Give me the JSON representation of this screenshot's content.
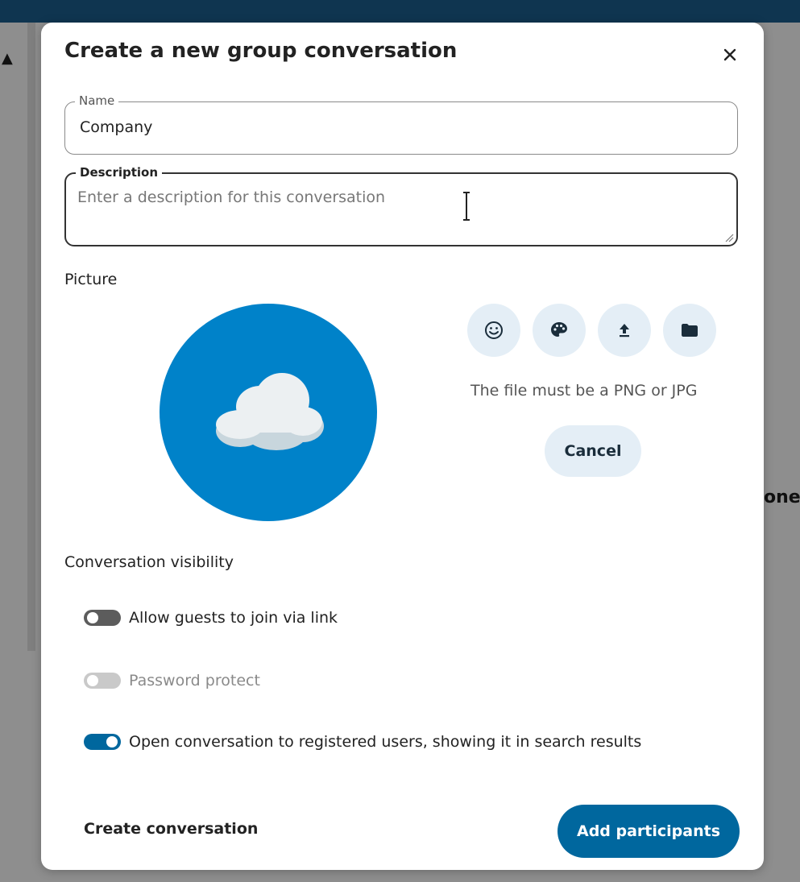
{
  "dialog": {
    "title": "Create a new group conversation",
    "close_icon": "close-icon"
  },
  "name_field": {
    "legend": "Name",
    "value": "Company"
  },
  "description_field": {
    "legend": "Description",
    "placeholder": "Enter a description for this conversation"
  },
  "picture": {
    "label": "Picture",
    "avatar_icon": "cloud-icon",
    "avatar_color": "#0082c9",
    "actions": [
      {
        "icon": "emoji-icon"
      },
      {
        "icon": "palette-icon"
      },
      {
        "icon": "upload-icon"
      },
      {
        "icon": "folder-icon"
      }
    ],
    "hint": "The file must be a PNG or JPG",
    "cancel_label": "Cancel"
  },
  "visibility": {
    "label": "Conversation visibility",
    "toggles": [
      {
        "label": "Allow guests to join via link",
        "state": "off",
        "enabled": true
      },
      {
        "label": "Password protect",
        "state": "off",
        "enabled": false
      },
      {
        "label": "Open conversation to registered users, showing it in search results",
        "state": "on",
        "enabled": true
      }
    ]
  },
  "footer": {
    "create_label": "Create conversation",
    "add_participants_label": "Add participants"
  },
  "background": {
    "partial_text": "one"
  },
  "colors": {
    "primary": "#00679e",
    "secondary_button": "#e4eef6",
    "topbar": "#0f3550"
  }
}
